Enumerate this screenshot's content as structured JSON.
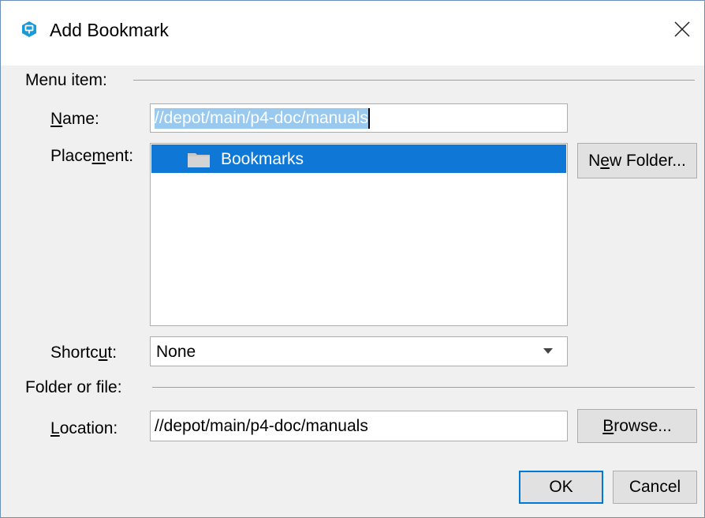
{
  "window": {
    "title": "Add Bookmark",
    "close_icon": "close-icon",
    "app_icon": "perforce-logo-icon"
  },
  "menu_item_section": {
    "heading": "Menu item:",
    "name": {
      "label_pre": "",
      "label_mnemonic": "N",
      "label_post": "ame:",
      "value": "//depot/main/p4-doc/manuals",
      "selected": true
    },
    "placement": {
      "label_pre": "Place",
      "label_mnemonic": "m",
      "label_post": "ent:",
      "items": [
        {
          "label": "Bookmarks",
          "icon": "folder-icon",
          "selected": true
        }
      ]
    },
    "new_folder_button": {
      "label_pre": "N",
      "label_mnemonic": "e",
      "label_post": "w Folder..."
    },
    "shortcut": {
      "label_pre": "Shortc",
      "label_mnemonic": "u",
      "label_post": "t:",
      "value": "None",
      "icon": "chevron-down-icon"
    }
  },
  "folder_section": {
    "heading": "Folder or file:",
    "location": {
      "label_pre": "",
      "label_mnemonic": "L",
      "label_post": "ocation:",
      "value": "//depot/main/p4-doc/manuals"
    },
    "browse_button": {
      "label_pre": "",
      "label_mnemonic": "B",
      "label_post": "rowse..."
    }
  },
  "footer": {
    "ok_label": "OK",
    "cancel_label": "Cancel"
  },
  "colors": {
    "selection": "#0f78d7",
    "text_selection": "#99c9ef",
    "default_button_border": "#0078d7",
    "dialog_background": "#f0f0f0"
  }
}
